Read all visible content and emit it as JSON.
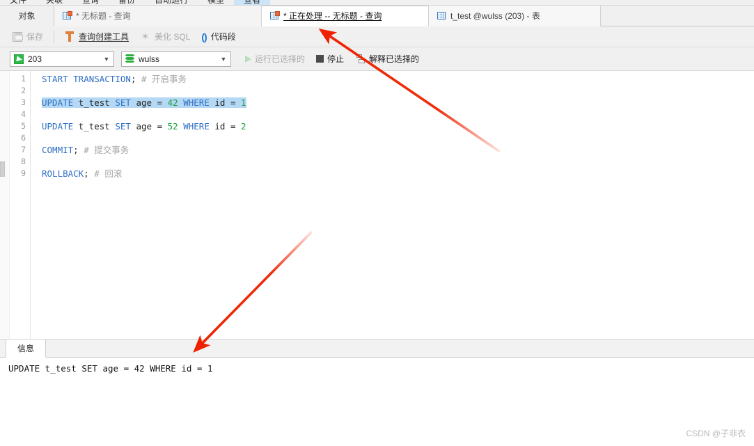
{
  "ribbon": {
    "items": [
      {
        "label": "文件",
        "active": false
      },
      {
        "label": "关联",
        "active": false
      },
      {
        "label": "查询",
        "active": false
      },
      {
        "label": "备份",
        "active": false
      },
      {
        "label": "自动运行",
        "active": false
      },
      {
        "label": "模型",
        "active": false
      },
      {
        "label": "查看",
        "active": true
      }
    ]
  },
  "tabbar": {
    "objects_tab": "对象",
    "tabs": [
      {
        "label": "* 无标题 - 查询",
        "icon": "grid-table-icon",
        "state": "inactive"
      },
      {
        "label": "* 正在处理 -- 无标题 - 查询",
        "icon": "grid-table-icon",
        "state": "active"
      },
      {
        "label": "t_test @wulss (203) - 表",
        "icon": "grid-table-plain-icon",
        "state": "side"
      }
    ]
  },
  "toolbar": {
    "save_label": "保存",
    "query_builder_label": "查询创建工具",
    "beautify_sql_label": "美化 SQL",
    "code_snippet_label": "代码段"
  },
  "connection": {
    "connection_value": "203",
    "database_value": "wulss",
    "run_selected_label": "运行已选择的",
    "stop_label": "停止",
    "explain_selected_label": "解释已选择的"
  },
  "editor": {
    "line_numbers": [
      "1",
      "2",
      "3",
      "4",
      "5",
      "6",
      "7",
      "8",
      "9"
    ],
    "lines": [
      {
        "number": "1",
        "selected": false,
        "tokens": [
          {
            "t": "START TRANSACTION",
            "c": "kw"
          },
          {
            "t": ";",
            "c": "pun"
          },
          {
            "t": " # 开启事务",
            "c": "cmt"
          }
        ]
      },
      {
        "number": "2",
        "selected": false,
        "tokens": []
      },
      {
        "number": "3",
        "selected": true,
        "tokens": [
          {
            "t": "UPDATE",
            "c": "kw"
          },
          {
            "t": " t_test ",
            "c": "idt"
          },
          {
            "t": "SET",
            "c": "kw"
          },
          {
            "t": " age = ",
            "c": "idt"
          },
          {
            "t": "42",
            "c": "num"
          },
          {
            "t": " ",
            "c": "idt"
          },
          {
            "t": "WHERE",
            "c": "kw"
          },
          {
            "t": " id = ",
            "c": "idt"
          },
          {
            "t": "1",
            "c": "num"
          }
        ]
      },
      {
        "number": "4",
        "selected": false,
        "tokens": []
      },
      {
        "number": "5",
        "selected": false,
        "tokens": [
          {
            "t": "UPDATE",
            "c": "kw"
          },
          {
            "t": " t_test ",
            "c": "idt"
          },
          {
            "t": "SET",
            "c": "kw"
          },
          {
            "t": " age = ",
            "c": "idt"
          },
          {
            "t": "52",
            "c": "num"
          },
          {
            "t": " ",
            "c": "idt"
          },
          {
            "t": "WHERE",
            "c": "kw"
          },
          {
            "t": " id = ",
            "c": "idt"
          },
          {
            "t": "2",
            "c": "num"
          }
        ]
      },
      {
        "number": "6",
        "selected": false,
        "tokens": []
      },
      {
        "number": "7",
        "selected": false,
        "tokens": [
          {
            "t": "COMMIT",
            "c": "kw"
          },
          {
            "t": ";",
            "c": "pun"
          },
          {
            "t": " # 提交事务",
            "c": "cmt"
          }
        ]
      },
      {
        "number": "8",
        "selected": false,
        "tokens": []
      },
      {
        "number": "9",
        "selected": false,
        "tokens": [
          {
            "t": "ROLLBACK",
            "c": "kw"
          },
          {
            "t": ";",
            "c": "pun"
          },
          {
            "t": " # 回滚",
            "c": "cmt"
          }
        ]
      }
    ]
  },
  "info_panel": {
    "tab_label": "信息",
    "output_line": "UPDATE t_test SET age = 42 WHERE id = 1"
  },
  "watermark": "CSDN @子非衣",
  "colors": {
    "accent": "#2f6fc4",
    "number": "#1a9c3c",
    "selection": "#b5d9f5",
    "annotation": "#ee2200",
    "chrome": "#f0f0f0"
  }
}
